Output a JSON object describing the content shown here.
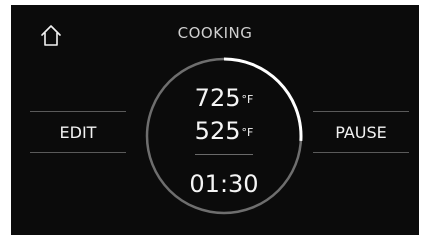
{
  "header": {
    "title": "COOKING",
    "home_icon": "home-icon"
  },
  "controls": {
    "edit_label": "EDIT",
    "pause_label": "PAUSE"
  },
  "dial": {
    "set_temperature": "725",
    "set_temperature_unit": "°F",
    "current_temperature": "525",
    "current_temperature_unit": "°F",
    "timer": "01:30",
    "progress_fraction": 0.26
  },
  "colors": {
    "screen_background": "#0b0b0b",
    "ring_track": "#6e6e6e",
    "ring_progress": "#ffffff",
    "text": "#f2f2f2"
  }
}
